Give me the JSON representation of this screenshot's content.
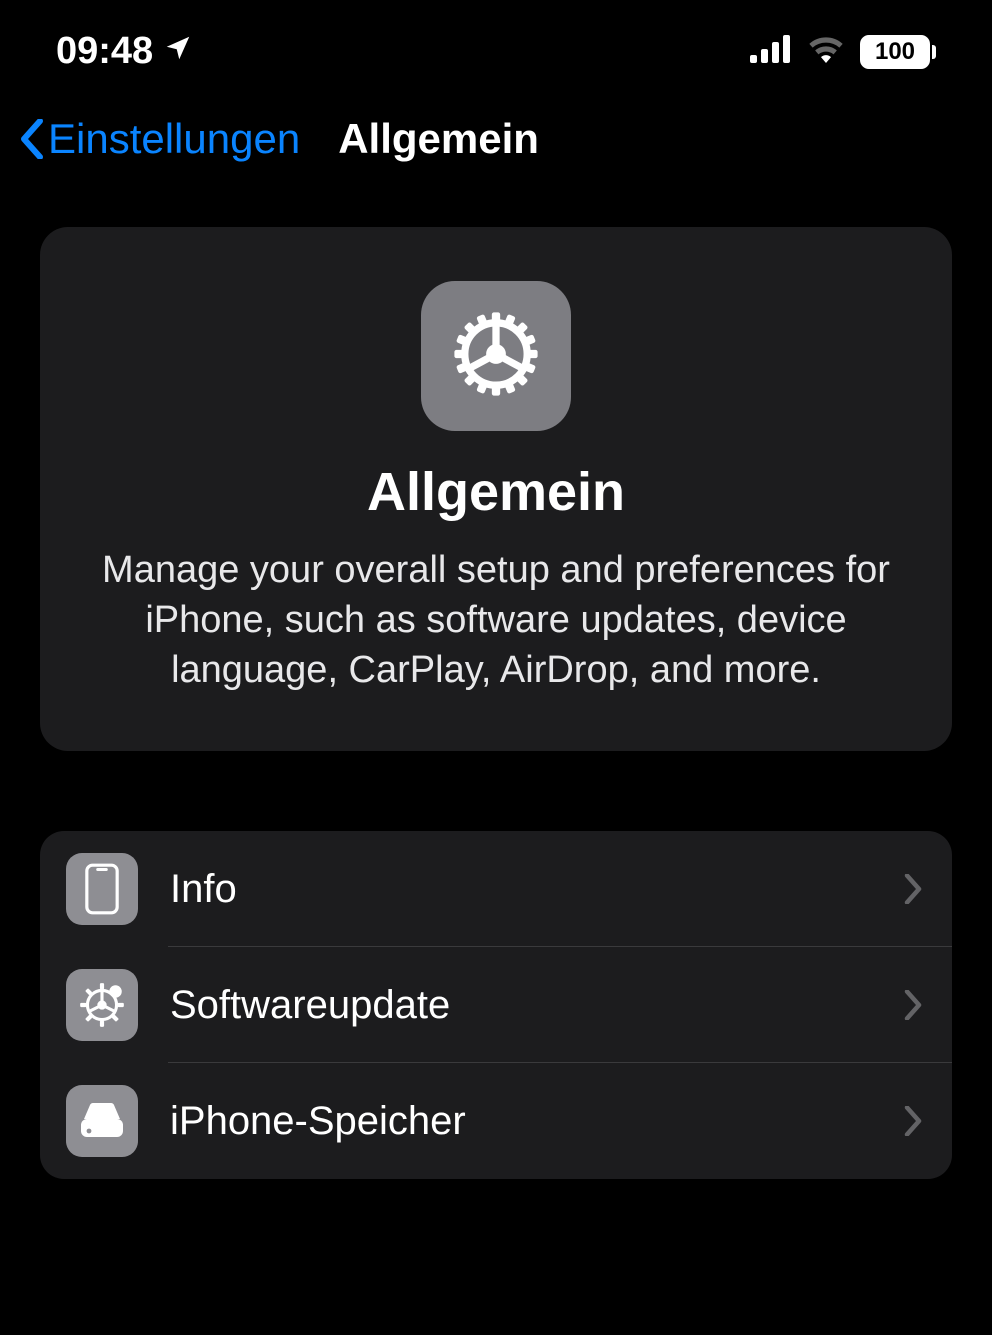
{
  "status_bar": {
    "time": "09:48",
    "battery_percent": "100"
  },
  "nav": {
    "back_label": "Einstellungen",
    "title": "Allgemein"
  },
  "hero": {
    "title": "Allgemein",
    "description": "Manage your overall setup and preferences for iPhone, such as software updates, device language, CarPlay, AirDrop, and more."
  },
  "list": {
    "items": [
      {
        "label": "Info",
        "icon": "iphone-icon"
      },
      {
        "label": "Softwareupdate",
        "icon": "gear-badge-icon"
      },
      {
        "label": "iPhone-Speicher",
        "icon": "storage-icon"
      }
    ]
  },
  "colors": {
    "accent": "#0a84ff",
    "card_bg": "#1c1c1e",
    "icon_bg": "#8e8e93"
  }
}
